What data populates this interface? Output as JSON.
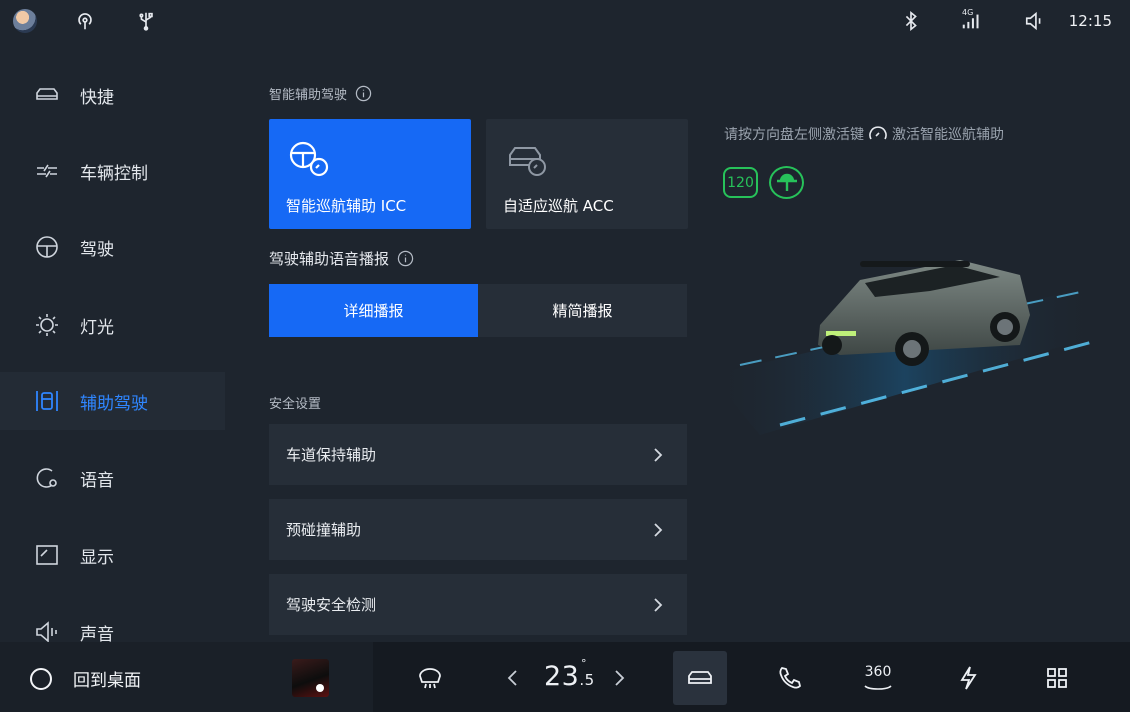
{
  "status_bar": {
    "time": "12:15",
    "icons": [
      "avatar",
      "hotspot-icon",
      "usb-icon",
      "bluetooth-icon",
      "signal-4g-icon",
      "volume-icon"
    ],
    "signal_label": "4G"
  },
  "sidebar": {
    "items": [
      {
        "label": "快捷",
        "icon": "car-shortcut-icon",
        "active": false
      },
      {
        "label": "车辆控制",
        "icon": "vehicle-control-icon",
        "active": false
      },
      {
        "label": "驾驶",
        "icon": "steering-wheel-icon",
        "active": false
      },
      {
        "label": "灯光",
        "icon": "light-bulb-icon",
        "active": false
      },
      {
        "label": "辅助驾驶",
        "icon": "assist-driving-icon",
        "active": true
      },
      {
        "label": "语音",
        "icon": "voice-icon",
        "active": false
      },
      {
        "label": "显示",
        "icon": "display-icon",
        "active": false
      },
      {
        "label": "声音",
        "icon": "sound-icon",
        "active": false
      }
    ]
  },
  "main": {
    "section_assist": {
      "title": "智能辅助驾驶"
    },
    "modes": [
      {
        "label": "智能巡航辅助 ICC",
        "selected": true
      },
      {
        "label": "自适应巡航 ACC",
        "selected": false
      }
    ],
    "section_voice": {
      "title": "驾驶辅助语音播报"
    },
    "voice_options": [
      {
        "label": "详细播报",
        "selected": true
      },
      {
        "label": "精简播报",
        "selected": false
      }
    ],
    "section_safety": {
      "title": "安全设置"
    },
    "safety_rows": [
      {
        "label": "车道保持辅助"
      },
      {
        "label": "预碰撞辅助"
      },
      {
        "label": "驾驶安全检测"
      }
    ]
  },
  "right_panel": {
    "hint_before": "请按方向盘左侧激活键",
    "hint_after": "激活智能巡航辅助",
    "speed_badge": "120"
  },
  "dock": {
    "home_label": "回到桌面",
    "temperature_whole": "23",
    "temperature_fraction": ".5",
    "temperature_degree": "°",
    "view_label": "360",
    "colors": {
      "accent": "#1669f5",
      "active_nav": "#2f86ff",
      "status_green": "#27c25a"
    }
  }
}
